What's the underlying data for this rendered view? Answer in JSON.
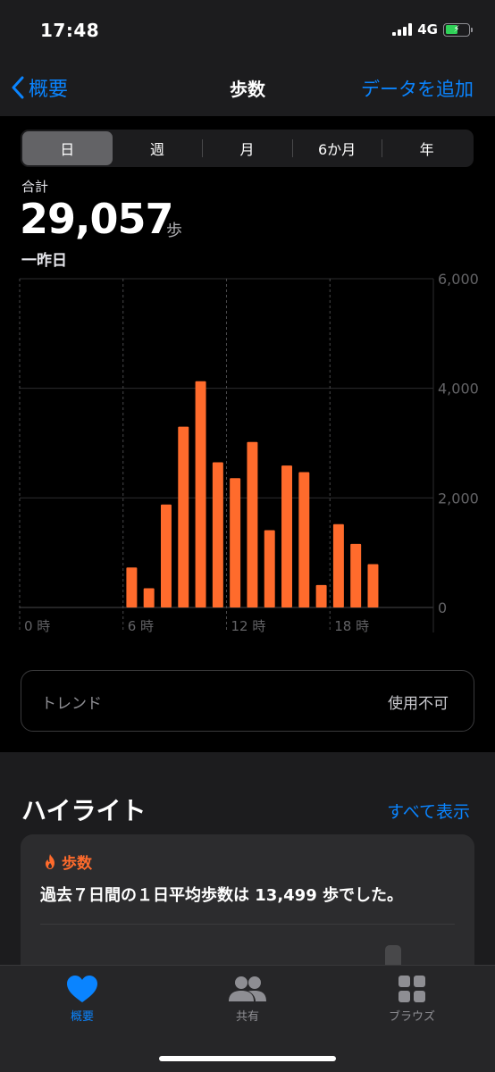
{
  "status": {
    "time": "17:48",
    "network": "4G",
    "battery_level_pct": 55
  },
  "nav": {
    "back_label": "概要",
    "title": "歩数",
    "action_label": "データを追加"
  },
  "segments": [
    {
      "label": "日",
      "selected": true
    },
    {
      "label": "週",
      "selected": false
    },
    {
      "label": "月",
      "selected": false
    },
    {
      "label": "6か月",
      "selected": false
    },
    {
      "label": "年",
      "selected": false
    }
  ],
  "summary": {
    "total_label": "合計",
    "total_value": "29,057",
    "unit": "歩",
    "date": "一昨日"
  },
  "chart_data": {
    "type": "bar",
    "bar_color": "#ff6b2c",
    "x_unit": "hour",
    "x_range": [
      0,
      24
    ],
    "x_ticks": [
      {
        "hour": 0,
        "label": "0 時"
      },
      {
        "hour": 6,
        "label": "6 時"
      },
      {
        "hour": 12,
        "label": "12 時"
      },
      {
        "hour": 18,
        "label": "18 時"
      }
    ],
    "ylim": [
      0,
      6000
    ],
    "y_ticks": [
      {
        "value": 6000,
        "label": "6,000"
      },
      {
        "value": 4000,
        "label": "4,000"
      },
      {
        "value": 2000,
        "label": "2,000"
      },
      {
        "value": 0,
        "label": "0"
      }
    ],
    "grid": true,
    "bars": [
      {
        "hour": 6,
        "value": 730
      },
      {
        "hour": 7,
        "value": 350
      },
      {
        "hour": 8,
        "value": 1880
      },
      {
        "hour": 9,
        "value": 3300
      },
      {
        "hour": 10,
        "value": 4130
      },
      {
        "hour": 11,
        "value": 2650
      },
      {
        "hour": 12,
        "value": 2360
      },
      {
        "hour": 13,
        "value": 3020
      },
      {
        "hour": 14,
        "value": 1410
      },
      {
        "hour": 15,
        "value": 2590
      },
      {
        "hour": 16,
        "value": 2470
      },
      {
        "hour": 17,
        "value": 410
      },
      {
        "hour": 18,
        "value": 1520
      },
      {
        "hour": 19,
        "value": 1160
      },
      {
        "hour": 20,
        "value": 790
      }
    ]
  },
  "trend": {
    "label": "トレンド",
    "value": "使用不可"
  },
  "highlights": {
    "title": "ハイライト",
    "show_all_label": "すべて表示",
    "card": {
      "category": "歩数",
      "text": "過去７日間の１日平均歩数は 13,499 歩でした。",
      "icon": "flame-icon"
    }
  },
  "tabs": [
    {
      "label": "概要",
      "icon": "heart-icon",
      "active": true
    },
    {
      "label": "共有",
      "icon": "people-icon",
      "active": false
    },
    {
      "label": "ブラウズ",
      "icon": "grid-icon",
      "active": false
    }
  ],
  "colors": {
    "accent": "#0a84ff",
    "steps": "#ff6b2c",
    "background": "#000000",
    "panel": "#1c1c1e"
  }
}
